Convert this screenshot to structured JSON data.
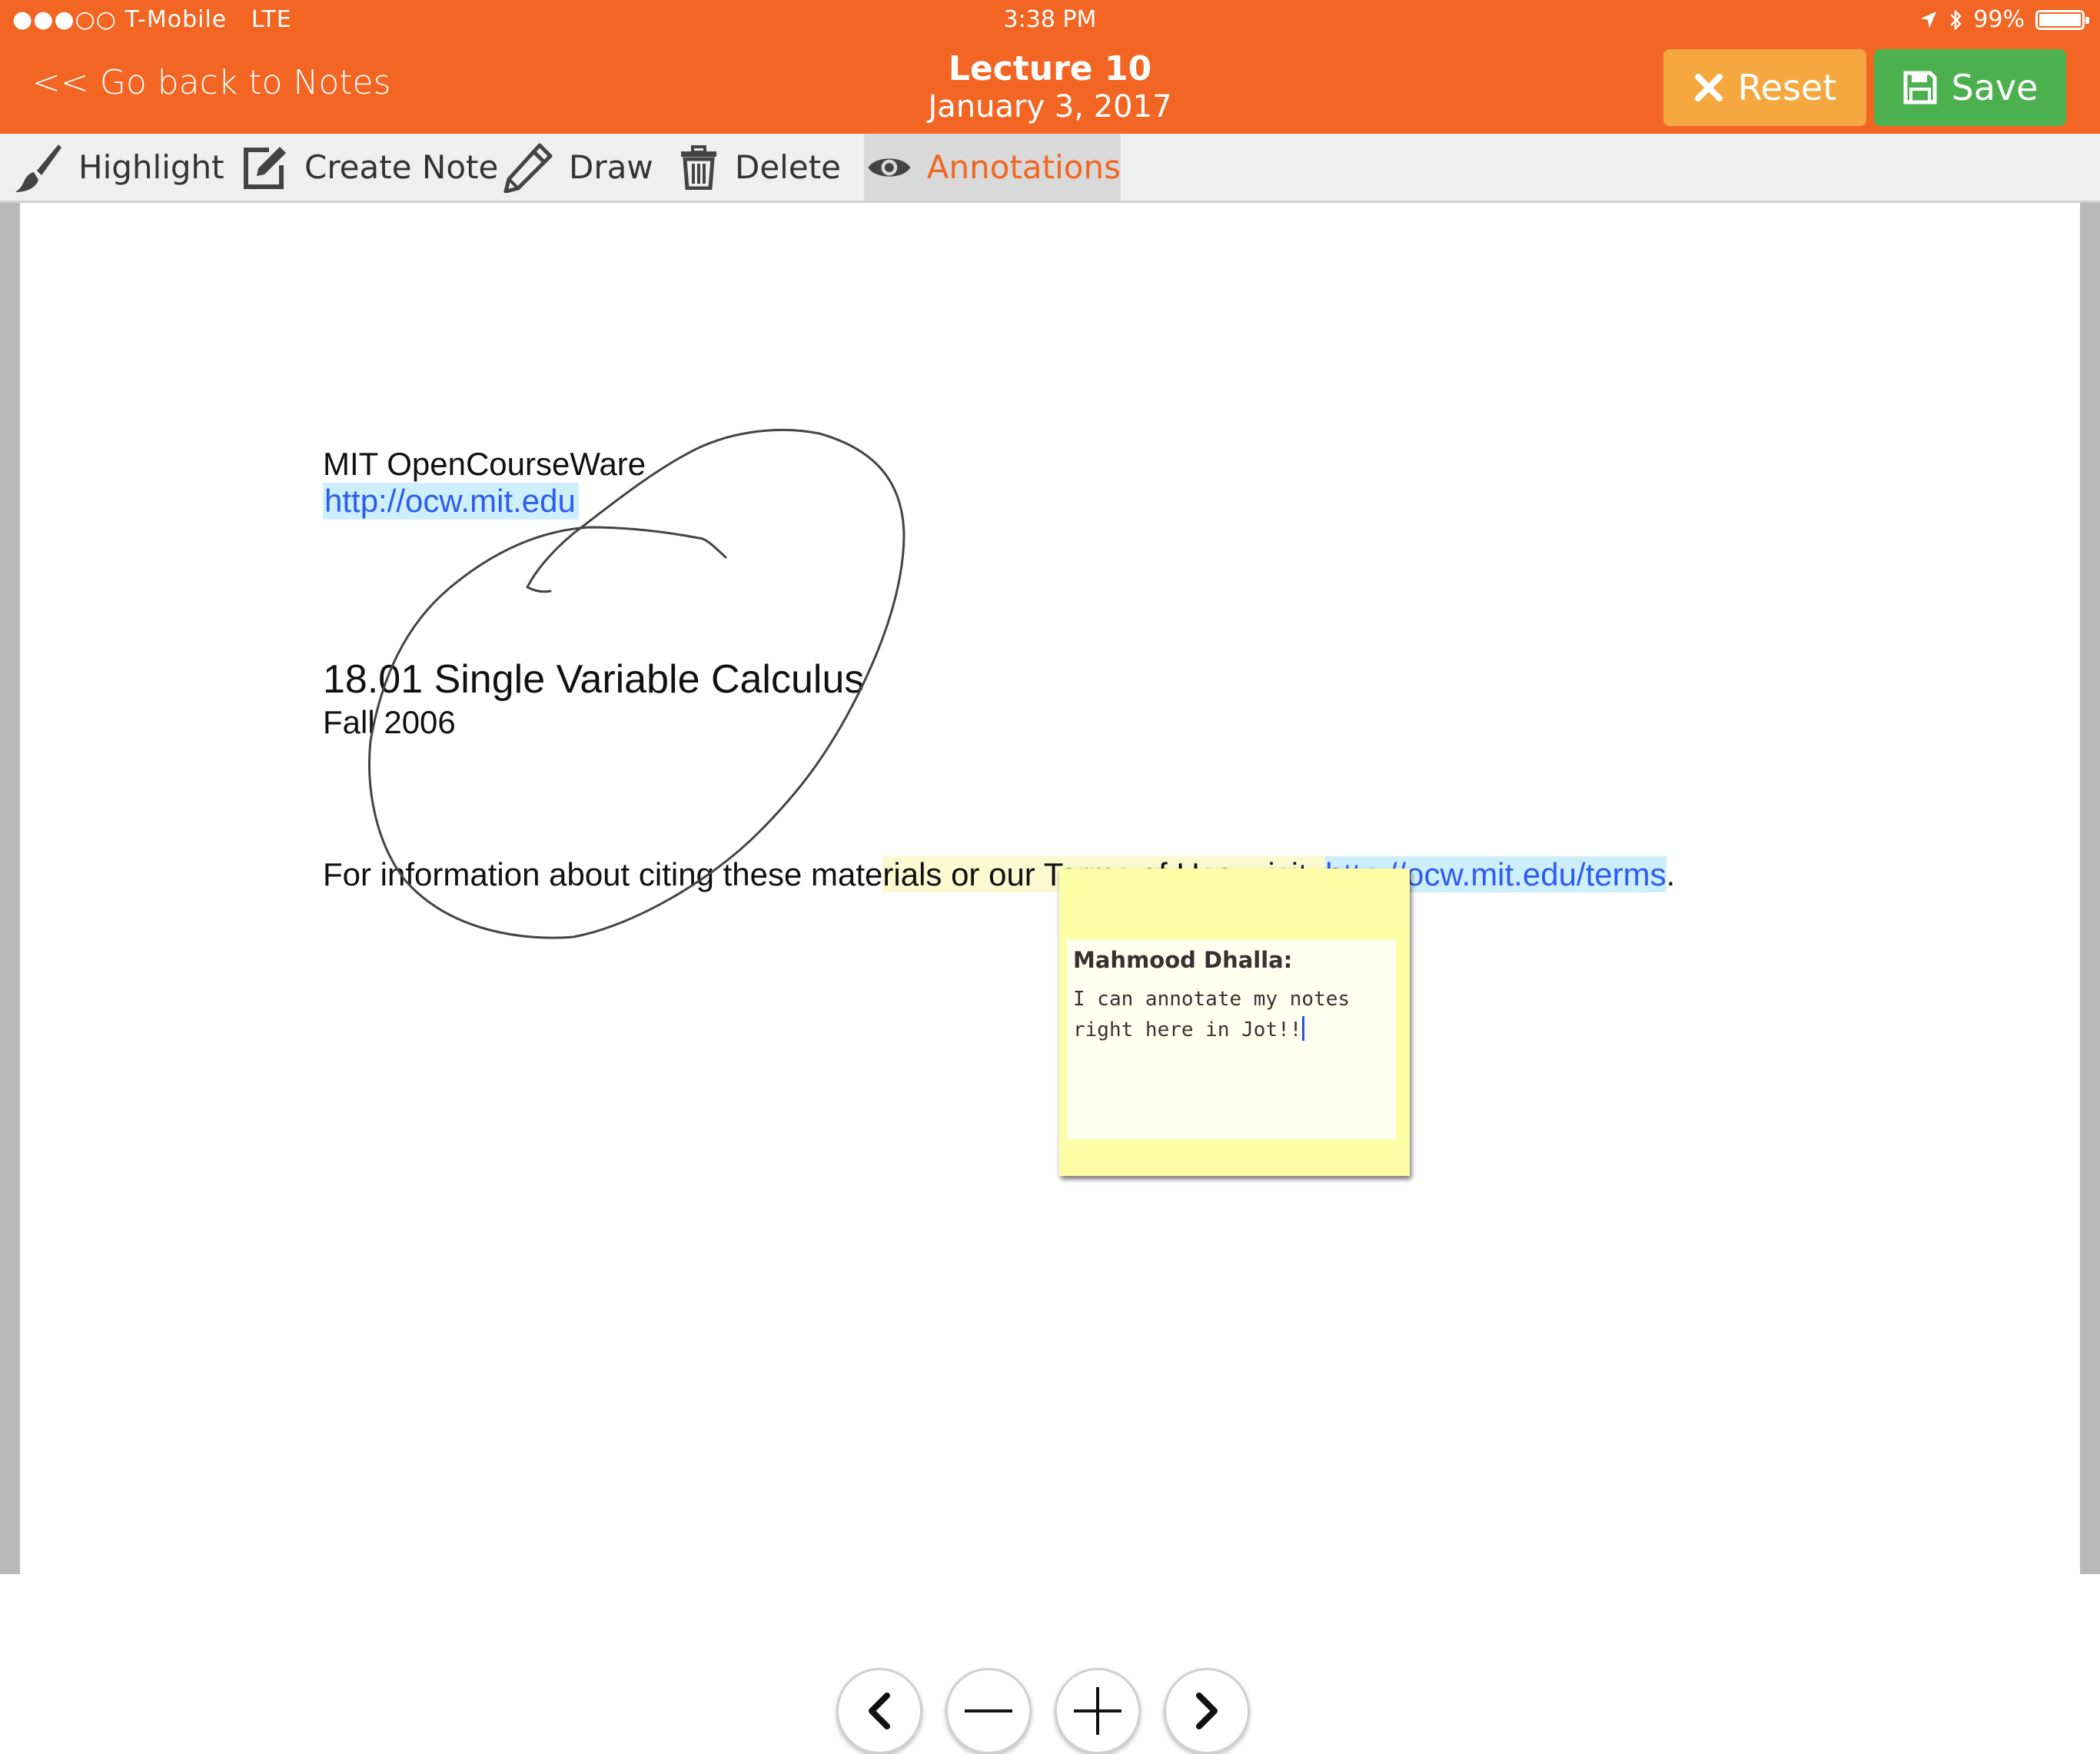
{
  "status_bar": {
    "signal": "●●●○○",
    "carrier": "T-Mobile",
    "network": "LTE",
    "time": "3:38 PM",
    "battery_percent": "99%",
    "battery_level": 0.99
  },
  "header": {
    "back_label": "<< Go back to Notes",
    "title": "Lecture 10",
    "date": "January 3, 2017",
    "reset_label": "Reset",
    "save_label": "Save",
    "colors": {
      "bar": "#f26522",
      "reset": "#f5a840",
      "save": "#4cb04f"
    }
  },
  "toolbar": {
    "highlight": "Highlight",
    "create_note": "Create Note",
    "draw": "Draw",
    "delete": "Delete",
    "annotations": "Annotations",
    "active_tool": "annotations",
    "icons": [
      "brush-icon",
      "edit-note-icon",
      "pencil-icon",
      "trash-icon",
      "eye-icon"
    ]
  },
  "document": {
    "org": "MIT OpenCourseWare",
    "org_url": "http://ocw.mit.edu",
    "course_title": "18.01 Single Variable Calculus",
    "term": "Fall 2006",
    "citation_prefix": "For information about citing these mate",
    "citation_highlighted": "rials or our Terms of Use, visit: ",
    "citation_url": "http://ocw.mit.edu/terms",
    "citation_suffix": "."
  },
  "note": {
    "author": "Mahmood Dhalla:",
    "text": "I can annotate my notes right here in Jot!!"
  },
  "navigation": {
    "icons": [
      "chevron-left-icon",
      "minus-icon",
      "plus-icon",
      "chevron-right-icon"
    ]
  }
}
